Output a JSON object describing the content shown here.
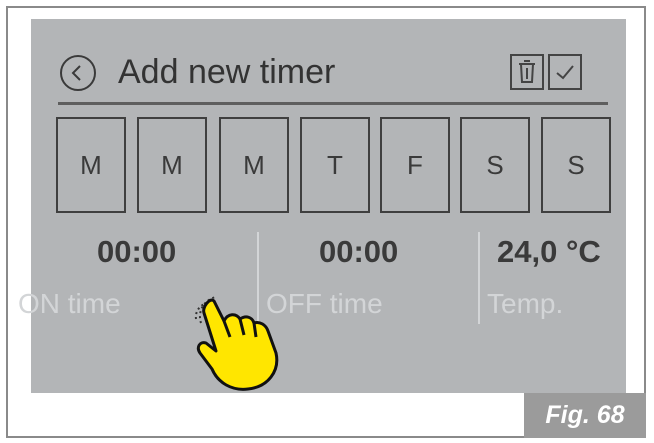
{
  "header": {
    "title": "Add new timer"
  },
  "icons": {
    "back": "chevron-left-icon",
    "delete": "trash-icon",
    "confirm": "check-icon",
    "pointer": "pointing-hand-icon"
  },
  "days": [
    "M",
    "M",
    "M",
    "T",
    "F",
    "S",
    "S"
  ],
  "on_time": {
    "value": "00:00",
    "label": "ON time"
  },
  "off_time": {
    "value": "00:00",
    "label": "OFF time"
  },
  "temperature": {
    "value": "24,0 °C",
    "label": "Temp."
  },
  "figure_label": "Fig. 68",
  "colors": {
    "screen": "#b3b5b7",
    "text": "#3a3a3a",
    "muted_label": "#d3d5d7",
    "hand": "#ffe600",
    "figure_tab": "#9b9b9b"
  }
}
